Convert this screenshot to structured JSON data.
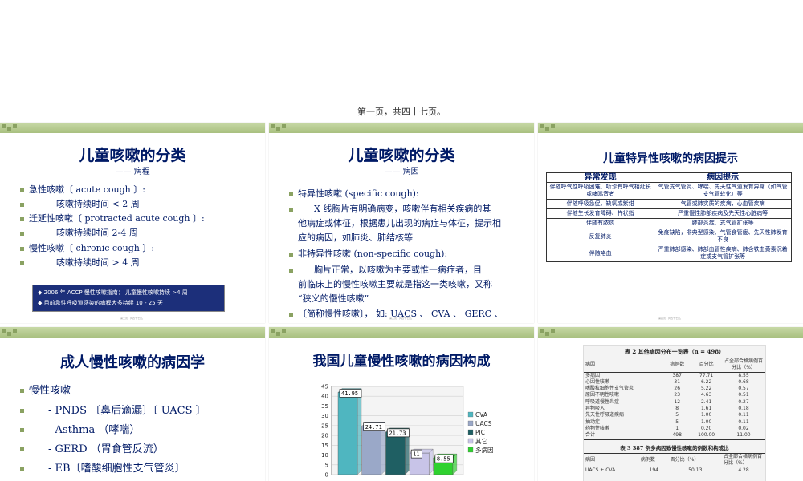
{
  "page_label": "第一页，共四十七页。",
  "slide1": {
    "title": "儿童咳嗽的分类",
    "subtitle": "—— 病程",
    "items": [
      "急性咳嗽〔 acute cough 〕:",
      "咳嗽持续时间 < 2 周",
      "迁延性咳嗽〔 protracted acute cough 〕:",
      "咳嗽持续时间 2-4 周",
      "慢性咳嗽〔 chronic cough 〕:",
      "咳嗽持续时间 > 4 周"
    ],
    "notes": [
      "2006 年 ACCP 慢性咳嗽指南：  儿童慢性咳嗽持续 >4 周",
      "目前急性呼吸道感染的病程大多持续 10 - 25 天"
    ],
    "footer": "第二页，共四十七页。"
  },
  "slide2": {
    "title": "儿童咳嗽的分类",
    "subtitle": "—— 病因",
    "lines": [
      "特异性咳嗽   (specific cough):",
      "X 线胸片有明确病变，咳嗽伴有相关疾病的其",
      "他病症或体征，根据患儿出现的病症与体征，提示相",
      "应的病因，如肺炎、肺结核等",
      "非特异性咳嗽  (non-specific cough):",
      "胸片正常，以咳嗽为主要或惟一病症者，目",
      "前临床上的慢性咳嗽主要就是指这一类咳嗽，又称",
      "“狭义的慢性咳嗽”",
      "〔简称慢性咳嗽〕，  如:   UACS 、 CVA 、 GERC 、"
    ],
    "footer": "第三页，共四十七页。"
  },
  "slide3": {
    "title": "儿童特异性咳嗽的病因提示",
    "headers": [
      "异常发现",
      "病因提示"
    ],
    "rows": [
      [
        "伴随呼气性呼吸困难、听诊有呼气相延长或哮鸣音者",
        "气管支气管炎、哮喘、先天性气道发育异常（如气管支气管软化）等"
      ],
      [
        "伴随呼吸急促、缺氧或紫绀",
        "气管或肺实质的疾病，心血管疾病"
      ],
      [
        "伴随生长发育障碍、杵状指",
        "严重慢性肺部疾病及先天性心脏病等"
      ],
      [
        "伴随有脓痰",
        "肺部炎症、支气管扩张等"
      ],
      [
        "反复肺炎",
        "免疫缺陷，非典型感染、气管食管瘘、先天性肺发育不良"
      ],
      [
        "伴随咯血",
        "严重肺部感染、肺部血管性疾病、肺含铁血黄素沉着症或支气管扩张等"
      ]
    ],
    "footer": "第四页，共四十七页。"
  },
  "slide4": {
    "title": "成人慢性咳嗽的病因学",
    "items": [
      "慢性咳嗽",
      "- PNDS 〔鼻后滴漏〕〔  UACS 〕",
      "- Asthma （哮喘）",
      "- GERD （胃食管反流）",
      "- EB〔嗜酸细胞性支气管炎〕"
    ]
  },
  "slide5": {
    "title": "我国儿童慢性咳嗽的病因构成"
  },
  "chart_data": {
    "type": "bar",
    "categories": [
      "CVA",
      "UACS",
      "PIC",
      "其它",
      "多病因"
    ],
    "values": [
      41.95,
      24.71,
      21.73,
      11,
      8.55
    ],
    "value_labels": [
      "41.95",
      "24.71",
      "21.73",
      "11",
      "8.55"
    ],
    "colors": [
      "#4fb6c0",
      "#9aa8c8",
      "#1f5f63",
      "#c8c4e8",
      "#2fd12f"
    ],
    "yticks": [
      "0",
      "5",
      "10",
      "15",
      "20",
      "25",
      "30",
      "35",
      "40",
      "45"
    ],
    "ylim": [
      0,
      45
    ],
    "legend": [
      "CVA",
      "UACS",
      "PIC",
      "其它",
      "多病因"
    ],
    "legend_position": "right",
    "grid": true
  },
  "slide6": {
    "table2_title": "表 2  其他病因分布一览表（n = 498）",
    "table2_headers": [
      "病因",
      "病例数",
      "百分比",
      "占全部合格病例百分比（%）"
    ],
    "table2_rows": [
      [
        "多病因",
        "387",
        "77.71",
        "8.55"
      ],
      [
        "心因性咳嗽",
        "31",
        "6.22",
        "0.68"
      ],
      [
        "嗜酸粒细胞性支气管炎",
        "26",
        "5.22",
        "0.57"
      ],
      [
        "原因不明性咳嗽",
        "23",
        "4.63",
        "0.51"
      ],
      [
        "呼吸道慢性炎症",
        "12",
        "2.41",
        "0.27"
      ],
      [
        "异物吸入",
        "8",
        "1.61",
        "0.18"
      ],
      [
        "先天性呼吸道疾病",
        "5",
        "1.00",
        "0.11"
      ],
      [
        "抽动症",
        "5",
        "1.00",
        "0.11"
      ],
      [
        "药物性咳嗽",
        "1",
        "0.20",
        "0.02"
      ],
      [
        "合计",
        "498",
        "100.00",
        "11.00"
      ]
    ],
    "table3_title": "表 3  387 例多病因致慢性咳嗽的例数和构成比",
    "table3_headers": [
      "病因",
      "病例数",
      "百分比（%）",
      "占全部合格病例百分比（%）"
    ],
    "table3_rows": [
      [
        "UACS + CVA",
        "194",
        "50.13",
        "4.28"
      ]
    ]
  }
}
